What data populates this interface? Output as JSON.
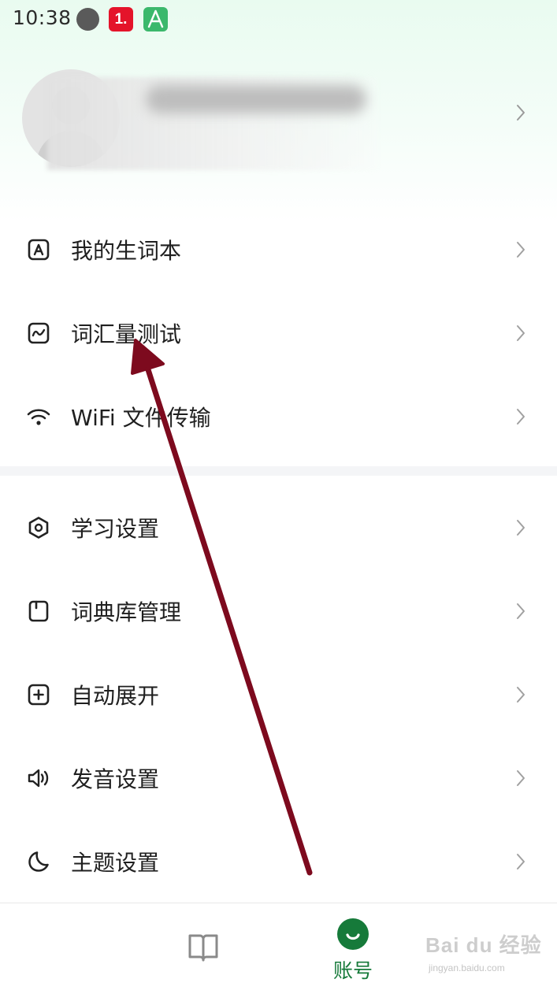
{
  "status_bar": {
    "time": "10:38",
    "notification_badge": "1."
  },
  "profile": {
    "chevron_icon": "chevron-right-icon"
  },
  "menu_group_1": [
    {
      "label": "我的生词本",
      "icon": "vocabulary-book-icon"
    },
    {
      "label": "词汇量测试",
      "icon": "vocabulary-test-icon"
    },
    {
      "label": "WiFi 文件传输",
      "icon": "wifi-icon"
    }
  ],
  "menu_group_2": [
    {
      "label": "学习设置",
      "icon": "hexagon-settings-icon"
    },
    {
      "label": "词典库管理",
      "icon": "dictionary-library-icon"
    },
    {
      "label": "自动展开",
      "icon": "expand-plus-icon"
    },
    {
      "label": "发音设置",
      "icon": "speaker-icon"
    },
    {
      "label": "主题设置",
      "icon": "moon-icon"
    }
  ],
  "bottom_nav": {
    "book_tab_icon": "book-icon",
    "account_label": "账号",
    "account_icon": "smile-account-icon"
  },
  "watermark": {
    "main": "Bai du 经验",
    "sub": "jingyan.baidu.com"
  },
  "colors": {
    "accent": "#167a3a",
    "arrow": "#7d0a1e",
    "header_gradient_top": "#e9fbf0"
  }
}
